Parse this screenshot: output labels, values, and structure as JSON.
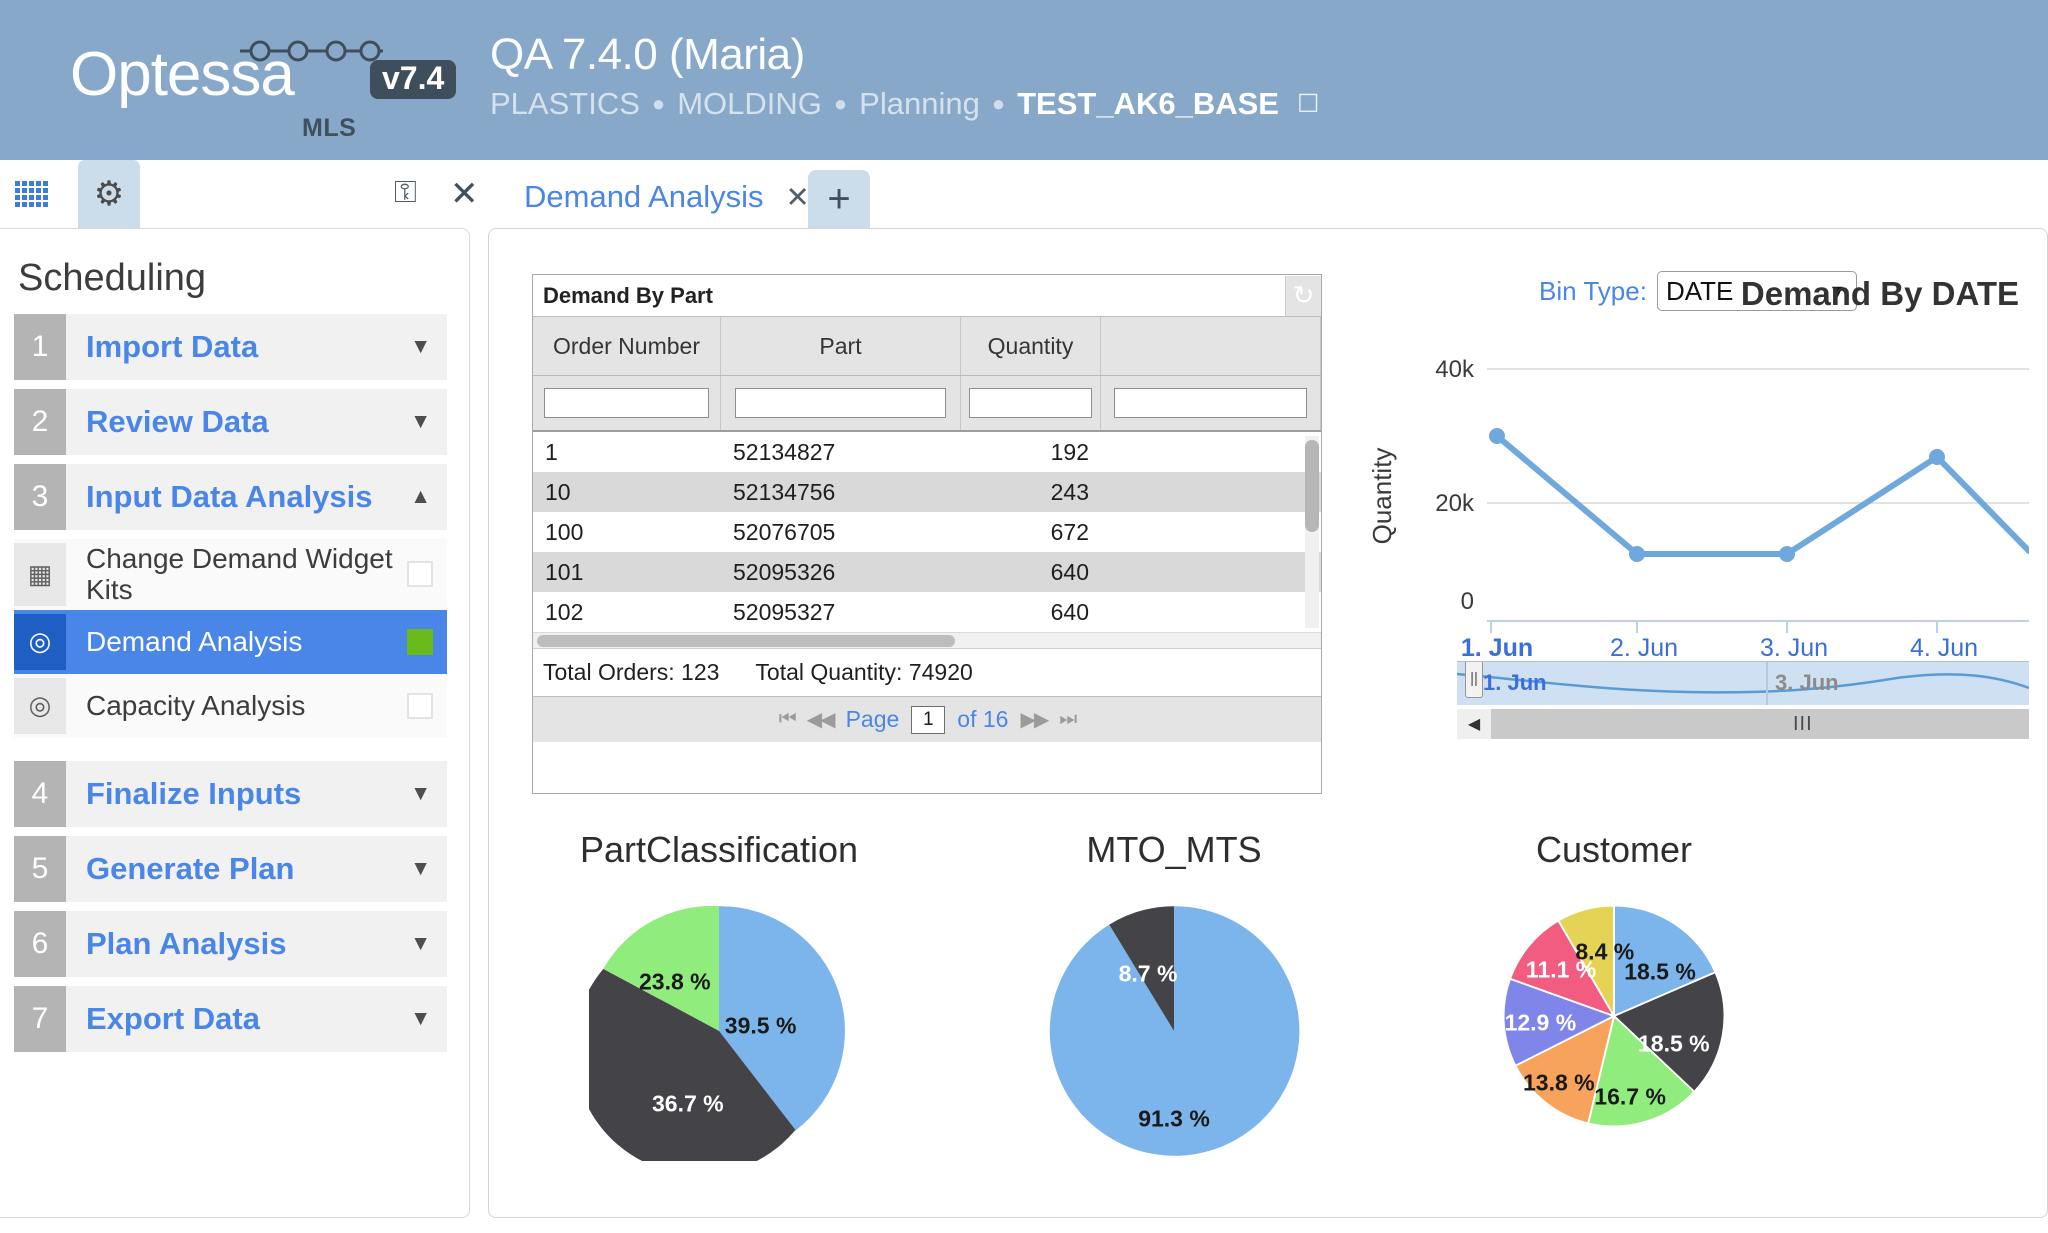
{
  "header": {
    "logo_word": "Optessa",
    "logo_version": "v7.4",
    "logo_sub": "MLS",
    "title": "QA 7.4.0 (Maria)",
    "breadcrumb": [
      "PLASTICS",
      "MOLDING",
      "Planning",
      "TEST_AK6_BASE"
    ],
    "breadcrumb_separator": "●",
    "edit_icon": "☐",
    "bg_color": "#88a8c9"
  },
  "icon_tabs": [
    {
      "name": "grid-view-tab",
      "icon": "grid-icon"
    },
    {
      "name": "settings-tab",
      "icon": "gear-icon",
      "glyph": "⚙"
    }
  ],
  "tabbar": {
    "lock_icon": "⚿",
    "close_icon": "✕",
    "tab_label": "Demand Analysis",
    "tab_close": "✕",
    "add_label": "+"
  },
  "sidebar": {
    "title": "Scheduling",
    "items": [
      {
        "num": "1",
        "label": "Import Data",
        "caret": "▼"
      },
      {
        "num": "2",
        "label": "Review Data",
        "caret": "▼"
      },
      {
        "num": "3",
        "label": "Input Data Analysis",
        "caret": "▲"
      },
      {
        "num": "4",
        "label": "Finalize Inputs",
        "caret": "▼"
      },
      {
        "num": "5",
        "label": "Generate Plan",
        "caret": "▼"
      },
      {
        "num": "6",
        "label": "Plan Analysis",
        "caret": "▼"
      },
      {
        "num": "7",
        "label": "Export Data",
        "caret": "▼"
      }
    ],
    "subitems": [
      {
        "label": "Change Demand Widget Kits",
        "icon": "table-icon",
        "glyph": "▦",
        "selected": false,
        "checked": false
      },
      {
        "label": "Demand Analysis",
        "icon": "target-icon",
        "glyph": "◎",
        "selected": true,
        "checked": true
      },
      {
        "label": "Capacity Analysis",
        "icon": "target-icon",
        "glyph": "◎",
        "selected": false,
        "checked": false
      }
    ],
    "checked_color": "#6aba1e",
    "selected_color": "#4a86e8"
  },
  "grid": {
    "title": "Demand By Part",
    "refresh_icon": "↻",
    "columns": [
      "Order Number",
      "Part",
      "Quantity",
      ""
    ],
    "filters": [
      "",
      "",
      "",
      ""
    ],
    "filter_placeholder": "",
    "rows": [
      {
        "order": "1",
        "part": "52134827",
        "qty": "192"
      },
      {
        "order": "10",
        "part": "52134756",
        "qty": "243"
      },
      {
        "order": "100",
        "part": "52076705",
        "qty": "672"
      },
      {
        "order": "101",
        "part": "52095326",
        "qty": "640"
      },
      {
        "order": "102",
        "part": "52095327",
        "qty": "640"
      }
    ],
    "total_orders_label": "Total Orders: 123",
    "total_quantity_label": "Total Quantity: 74920",
    "pager": {
      "first": "⏮",
      "prev": "◀◀",
      "page_label": "Page",
      "page_value": "1",
      "of_label": "of 16",
      "next": "▶▶",
      "last": "⏭"
    }
  },
  "line_panel": {
    "bin_type_label": "Bin Type:",
    "bin_type_value": "DATE",
    "bin_type_options": [
      "DATE"
    ],
    "navigator": {
      "left_label": "1. Jun",
      "right_label": "3. Jun",
      "scroll_left_icon": "◀",
      "grip": "III"
    }
  },
  "chart_data": [
    {
      "type": "line",
      "title": "Demand By DATE",
      "xlabel": "",
      "ylabel": "Quantity",
      "categories": [
        "1. Jun",
        "2. Jun",
        "3. Jun",
        "4. Jun"
      ],
      "values": [
        25000,
        8000,
        8000,
        22000
      ],
      "ylim": [
        0,
        45000
      ],
      "yticks": [
        0,
        20000,
        40000
      ],
      "ytick_labels": [
        "0",
        "20k",
        "40k"
      ],
      "grid": true,
      "legend": "none",
      "series_color": "#6fa8dc",
      "axis_label_color": "#3a6fd8"
    },
    {
      "type": "pie",
      "title": "PartClassification",
      "labels": [
        "39.5 %",
        "36.7 %",
        "23.8 %"
      ],
      "values": [
        39.5,
        36.7,
        23.8
      ],
      "colors": [
        "#7cb5ec",
        "#434348",
        "#90ed7d"
      ],
      "label_colors": [
        "#1a1a1a",
        "#ffffff",
        "#1a1a1a"
      ]
    },
    {
      "type": "pie",
      "title": "MTO_MTS",
      "labels": [
        "91.3 %",
        "8.7 %"
      ],
      "values": [
        91.3,
        8.7
      ],
      "colors": [
        "#7cb5ec",
        "#434348"
      ],
      "label_colors": [
        "#1a1a1a",
        "#ffffff"
      ]
    },
    {
      "type": "pie",
      "title": "Customer",
      "labels": [
        "18.5 %",
        "18.5 %",
        "16.7 %",
        "13.8 %",
        "12.9 %",
        "11.1 %",
        "8.4 %"
      ],
      "values": [
        18.5,
        18.5,
        16.7,
        13.8,
        12.9,
        11.1,
        8.4
      ],
      "colors": [
        "#7cb5ec",
        "#434348",
        "#90ed7d",
        "#f7a35c",
        "#8085e9",
        "#f15c80",
        "#e4d354"
      ],
      "label_colors": [
        "#1a1a1a",
        "#ffffff",
        "#1a1a1a",
        "#1a1a1a",
        "#ffffff",
        "#ffffff",
        "#1a1a1a"
      ]
    }
  ]
}
